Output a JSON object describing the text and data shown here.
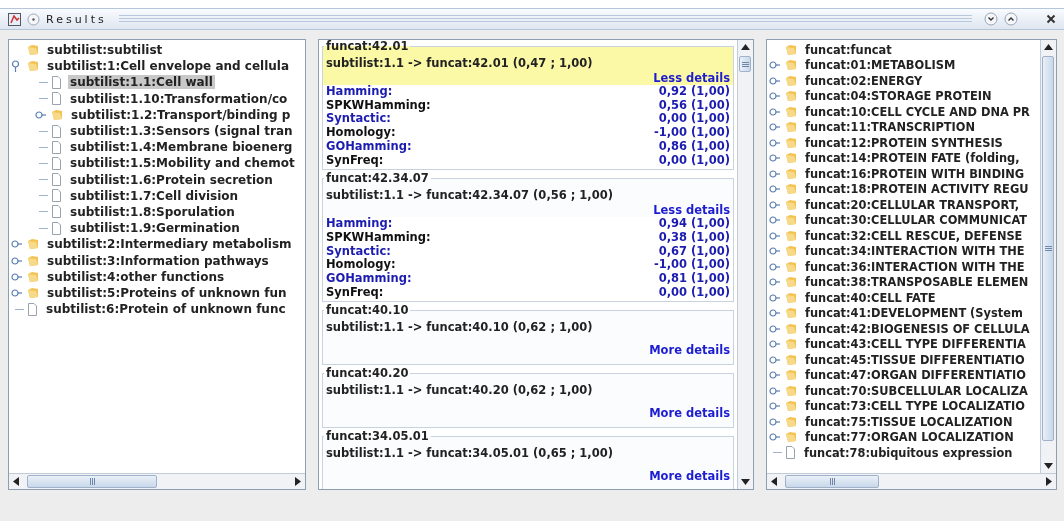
{
  "window": {
    "title": "Results"
  },
  "left_tree": {
    "label": "subtilist:subtilist",
    "kind": "folder",
    "selected": false,
    "children": [
      {
        "label": "subtilist:1:Cell envelope and cellula",
        "kind": "folder",
        "expanded": true,
        "selected": false,
        "children": [
          {
            "label": "subtilist:1.1:Cell wall",
            "kind": "leaf",
            "selected": true
          },
          {
            "label": "subtilist:1.10:Transformation/co",
            "kind": "leaf",
            "selected": false
          },
          {
            "label": "subtilist:1.2:Transport/binding p",
            "kind": "folder",
            "expanded": false,
            "selected": false
          },
          {
            "label": "subtilist:1.3:Sensors (signal tran",
            "kind": "leaf",
            "selected": false
          },
          {
            "label": "subtilist:1.4:Membrane bioenerg",
            "kind": "leaf",
            "selected": false
          },
          {
            "label": "subtilist:1.5:Mobility and chemot",
            "kind": "leaf",
            "selected": false
          },
          {
            "label": "subtilist:1.6:Protein secretion",
            "kind": "leaf",
            "selected": false
          },
          {
            "label": "subtilist:1.7:Cell division",
            "kind": "leaf",
            "selected": false
          },
          {
            "label": "subtilist:1.8:Sporulation",
            "kind": "leaf",
            "selected": false
          },
          {
            "label": "subtilist:1.9:Germination",
            "kind": "leaf",
            "selected": false
          }
        ]
      },
      {
        "label": "subtilist:2:Intermediary metabolism",
        "kind": "folder",
        "expanded": false,
        "selected": false
      },
      {
        "label": "subtilist:3:Information pathways",
        "kind": "folder",
        "expanded": false,
        "selected": false
      },
      {
        "label": "subtilist:4:other functions",
        "kind": "folder",
        "expanded": false,
        "selected": false
      },
      {
        "label": "subtilist:5:Proteins of unknown fun",
        "kind": "folder",
        "expanded": false,
        "selected": false
      },
      {
        "label": "subtilist:6:Protein of unknown func",
        "kind": "leaf",
        "selected": false
      }
    ]
  },
  "results": [
    {
      "title": "funcat:42.01",
      "mapping": "subtilist:1.1 -> funcat:42.01 (0,47 ; 1,00)",
      "selected": true,
      "expanded": true,
      "link": "Less details",
      "metrics": [
        {
          "name": "Hamming:",
          "value": "0,92 (1,00)",
          "color": "#1c1cb0"
        },
        {
          "name": "SPKWHamming:",
          "value": "0,56 (1,00)",
          "color": "#111111"
        },
        {
          "name": "Syntactic:",
          "value": "0,00 (1,00)",
          "color": "#1c1cb0"
        },
        {
          "name": "Homology:",
          "value": "-1,00 (1,00)",
          "color": "#111111"
        },
        {
          "name": "GOHamming:",
          "value": "0,86 (1,00)",
          "color": "#1c1cb0"
        },
        {
          "name": "SynFreq:",
          "value": "0,00 (1,00)",
          "color": "#111111"
        }
      ]
    },
    {
      "title": "funcat:42.34.07",
      "mapping": "subtilist:1.1 -> funcat:42.34.07 (0,56 ; 1,00)",
      "selected": false,
      "expanded": true,
      "link": "Less details",
      "metrics": [
        {
          "name": "Hamming:",
          "value": "0,94 (1,00)",
          "color": "#1c1cb0"
        },
        {
          "name": "SPKWHamming:",
          "value": "0,38 (1,00)",
          "color": "#111111"
        },
        {
          "name": "Syntactic:",
          "value": "0,67 (1,00)",
          "color": "#1c1cb0"
        },
        {
          "name": "Homology:",
          "value": "-1,00 (1,00)",
          "color": "#111111"
        },
        {
          "name": "GOHamming:",
          "value": "0,81 (1,00)",
          "color": "#1c1cb0"
        },
        {
          "name": "SynFreq:",
          "value": "0,00 (1,00)",
          "color": "#111111"
        }
      ]
    },
    {
      "title": "funcat:40.10",
      "mapping": "subtilist:1.1 -> funcat:40.10 (0,62 ; 1,00)",
      "selected": false,
      "expanded": false,
      "link": "More details"
    },
    {
      "title": "funcat:40.20",
      "mapping": "subtilist:1.1 -> funcat:40.20 (0,62 ; 1,00)",
      "selected": false,
      "expanded": false,
      "link": "More details"
    },
    {
      "title": "funcat:34.05.01",
      "mapping": "subtilist:1.1 -> funcat:34.05.01 (0,65 ; 1,00)",
      "selected": false,
      "expanded": false,
      "link": "More details"
    }
  ],
  "right_tree": {
    "label": "funcat:funcat",
    "kind": "folder",
    "selected": false,
    "children": [
      {
        "label": "funcat:01:METABOLISM",
        "kind": "folder",
        "expanded": false,
        "selected": false
      },
      {
        "label": "funcat:02:ENERGY",
        "kind": "folder",
        "expanded": false,
        "selected": false
      },
      {
        "label": "funcat:04:STORAGE PROTEIN",
        "kind": "folder",
        "expanded": false,
        "selected": false
      },
      {
        "label": "funcat:10:CELL CYCLE AND DNA PR",
        "kind": "folder",
        "expanded": false,
        "selected": false
      },
      {
        "label": "funcat:11:TRANSCRIPTION",
        "kind": "folder",
        "expanded": false,
        "selected": false
      },
      {
        "label": "funcat:12:PROTEIN SYNTHESIS",
        "kind": "folder",
        "expanded": false,
        "selected": false
      },
      {
        "label": "funcat:14:PROTEIN FATE (folding,",
        "kind": "folder",
        "expanded": false,
        "selected": false
      },
      {
        "label": "funcat:16:PROTEIN WITH BINDING",
        "kind": "folder",
        "expanded": false,
        "selected": false
      },
      {
        "label": "funcat:18:PROTEIN ACTIVITY REGU",
        "kind": "folder",
        "expanded": false,
        "selected": false
      },
      {
        "label": "funcat:20:CELLULAR TRANSPORT,",
        "kind": "folder",
        "expanded": false,
        "selected": false
      },
      {
        "label": "funcat:30:CELLULAR COMMUNICAT",
        "kind": "folder",
        "expanded": false,
        "selected": false
      },
      {
        "label": "funcat:32:CELL RESCUE, DEFENSE",
        "kind": "folder",
        "expanded": false,
        "selected": false
      },
      {
        "label": "funcat:34:INTERACTION WITH THE",
        "kind": "folder",
        "expanded": false,
        "selected": false
      },
      {
        "label": "funcat:36:INTERACTION WITH THE",
        "kind": "folder",
        "expanded": false,
        "selected": false
      },
      {
        "label": "funcat:38:TRANSPOSABLE ELEMEN",
        "kind": "folder",
        "expanded": false,
        "selected": false
      },
      {
        "label": "funcat:40:CELL FATE",
        "kind": "folder",
        "expanded": false,
        "selected": false
      },
      {
        "label": "funcat:41:DEVELOPMENT (System",
        "kind": "folder",
        "expanded": false,
        "selected": false
      },
      {
        "label": "funcat:42:BIOGENESIS OF CELLULA",
        "kind": "folder",
        "expanded": false,
        "selected": false
      },
      {
        "label": "funcat:43:CELL TYPE DIFFERENTIA",
        "kind": "folder",
        "expanded": false,
        "selected": false
      },
      {
        "label": "funcat:45:TISSUE DIFFERENTIATIO",
        "kind": "folder",
        "expanded": false,
        "selected": false
      },
      {
        "label": "funcat:47:ORGAN DIFFERENTIATIO",
        "kind": "folder",
        "expanded": false,
        "selected": false
      },
      {
        "label": "funcat:70:SUBCELLULAR LOCALIZA",
        "kind": "folder",
        "expanded": false,
        "selected": false
      },
      {
        "label": "funcat:73:CELL TYPE LOCALIZATIO",
        "kind": "folder",
        "expanded": false,
        "selected": false
      },
      {
        "label": "funcat:75:TISSUE LOCALIZATION",
        "kind": "folder",
        "expanded": false,
        "selected": false
      },
      {
        "label": "funcat:77:ORGAN LOCALIZATION",
        "kind": "folder",
        "expanded": false,
        "selected": false
      },
      {
        "label": "funcat:78:ubiquitous expression",
        "kind": "leaf",
        "selected": false
      }
    ]
  }
}
